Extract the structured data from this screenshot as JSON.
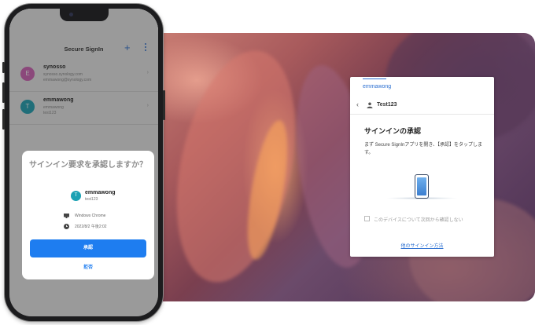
{
  "desktop": {
    "card": {
      "account_top": "emmawong",
      "user": "Test123",
      "title": "サインインの承認",
      "desc": "まず Secure SignInアプリを開き、【承認】をタップします。",
      "checkbox_label": "このデバイスについて次回から確認しない",
      "other_link": "他のサインイン方法"
    }
  },
  "phone": {
    "header": {
      "title": "Secure SignIn"
    },
    "accounts": [
      {
        "initial": "E",
        "name": "synosso",
        "sub1": "synosso.synology.com",
        "sub2": "emmawong@synology.com",
        "color": "#d35fb7"
      },
      {
        "initial": "T",
        "name": "emmawong",
        "sub1": "emmawong",
        "sub2": "test123",
        "color": "#1aa1b3"
      }
    ],
    "sheet": {
      "question": "サインイン要求を承認しますか？",
      "avatar_initial": "T",
      "username": "emmawong",
      "userid": "test123",
      "device": "Windows Chrome",
      "time": "2022/8/2 午後2:02",
      "approve": "承認",
      "deny": "拒否"
    }
  },
  "colors": {
    "accent": "#1e7df0",
    "link": "#2b6fd1"
  }
}
